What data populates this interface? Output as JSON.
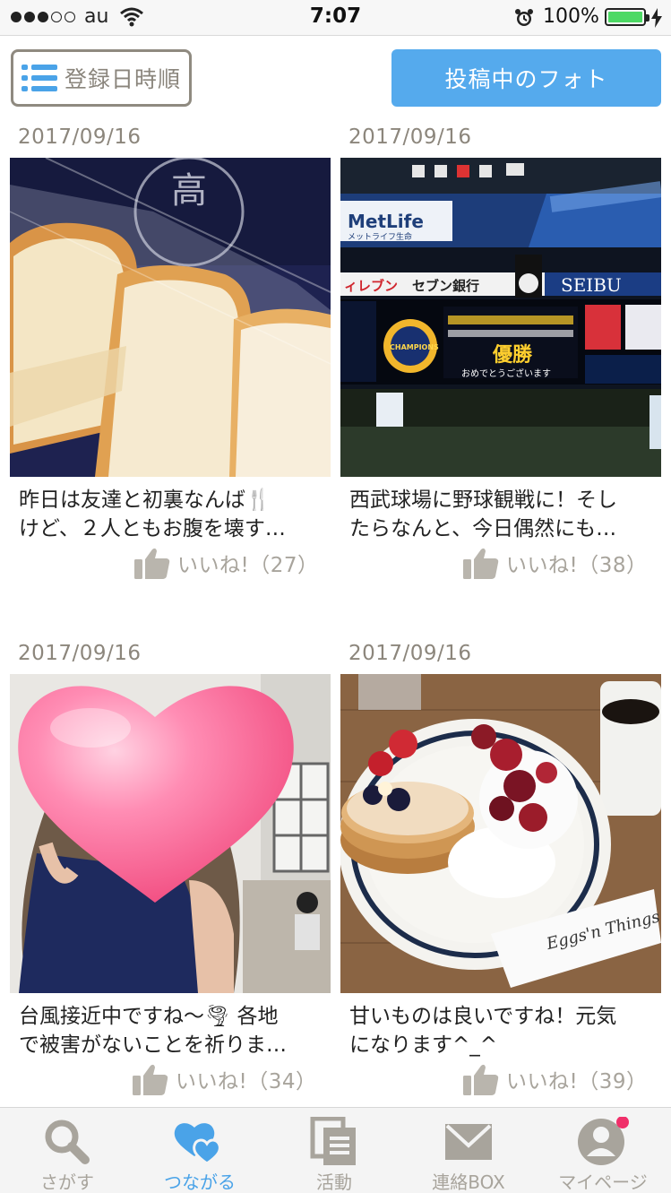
{
  "status_bar": {
    "carrier": "au",
    "time": "7:07",
    "battery_percent": "100%",
    "signal_bars": 3,
    "signal_total": 5,
    "battery_color": "#4cd964"
  },
  "toolbar": {
    "sort_label": "登録日時順",
    "posting_label": "投稿中のフォト",
    "accent_color": "#55aaed"
  },
  "posts": [
    {
      "date": "2017/09/16",
      "caption_line1": "昨日は友達と初裏なんば🍴",
      "caption_line2": "けど、２人ともお腹を壊す…",
      "like_label": "いいね!（27）",
      "photo_subject": "bread"
    },
    {
      "date": "2017/09/16",
      "caption_line1": "西武球場に野球観戦に！そし",
      "caption_line2": "たらなんと、今日偶然にも…",
      "like_label": "いいね!（38）",
      "photo_subject": "stadium"
    },
    {
      "date": "2017/09/16",
      "caption_line1": "台風接近中ですね〜🌪 各地",
      "caption_line2": "で被害がないことを祈りま…",
      "like_label": "いいね!（34）",
      "photo_subject": "heart-selfie"
    },
    {
      "date": "2017/09/16",
      "caption_line1": "甘いものは良いですね！元気",
      "caption_line2": "になります^_^",
      "like_label": "いいね!（39）",
      "photo_subject": "pancakes"
    }
  ],
  "tabs": [
    {
      "label": "さがす",
      "icon": "search-icon",
      "active": false
    },
    {
      "label": "つながる",
      "icon": "hearts-icon",
      "active": true
    },
    {
      "label": "活動",
      "icon": "documents-icon",
      "active": false
    },
    {
      "label": "連絡BOX",
      "icon": "mail-icon",
      "active": false
    },
    {
      "label": "マイページ",
      "icon": "user-icon",
      "active": false,
      "badge": true
    }
  ],
  "photo_texts": {
    "stadium_sponsor": "MetLife",
    "stadium_sponsor_sub": "メットライフ生命",
    "stadium_bank": "セブン銀行",
    "stadium_seibu": "SEIBU",
    "stadium_champions": "CHAMPIONS",
    "stadium_win": "優勝",
    "stadium_congrats": "おめでとうございます",
    "pancake_brand": "Eggs'n Things"
  },
  "colors": {
    "tab_active": "#4aa3e8",
    "tab_inactive": "#a8a49c",
    "badge": "#f0306a"
  }
}
